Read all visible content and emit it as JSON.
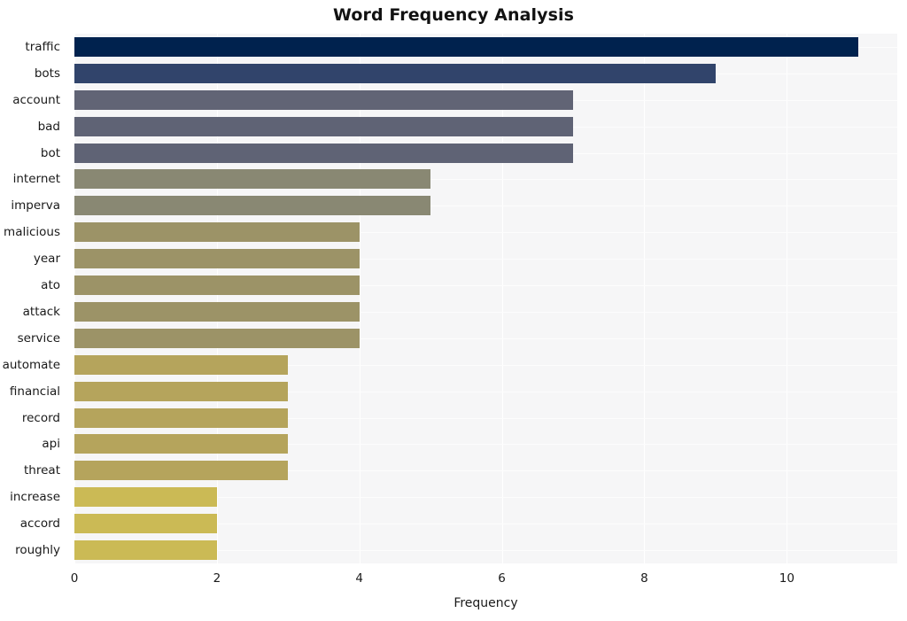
{
  "chart_data": {
    "type": "bar",
    "orientation": "horizontal",
    "title": "Word Frequency Analysis",
    "xlabel": "Frequency",
    "ylabel": "",
    "xlim": [
      0,
      11.55
    ],
    "xticks": [
      0,
      2,
      4,
      6,
      8,
      10
    ],
    "xtick_labels": [
      "0",
      "2",
      "4",
      "6",
      "8",
      "10"
    ],
    "grid": true,
    "legend": null,
    "categories": [
      "traffic",
      "bots",
      "account",
      "bad",
      "bot",
      "internet",
      "imperva",
      "malicious",
      "year",
      "ato",
      "attack",
      "service",
      "automate",
      "financial",
      "record",
      "api",
      "threat",
      "increase",
      "accord",
      "roughly"
    ],
    "values": [
      11,
      9,
      7,
      7,
      7,
      5,
      5,
      4,
      4,
      4,
      4,
      4,
      3,
      3,
      3,
      3,
      3,
      2,
      2,
      2
    ],
    "bar_colors": [
      "#00224e",
      "#31446b",
      "#616475",
      "#5f6375",
      "#5f6375",
      "#898873",
      "#898873",
      "#9c9367",
      "#9c9367",
      "#9c9367",
      "#9c9367",
      "#9c9367",
      "#b5a45c",
      "#b5a45c",
      "#b5a45c",
      "#b5a45c",
      "#b5a45c",
      "#cbba55",
      "#cbba55",
      "#cbba55"
    ],
    "colormap": "cividis",
    "plot_background": "#f6f6f7",
    "figure_background": "#ffffff",
    "gridline_color": "#ffffff"
  }
}
